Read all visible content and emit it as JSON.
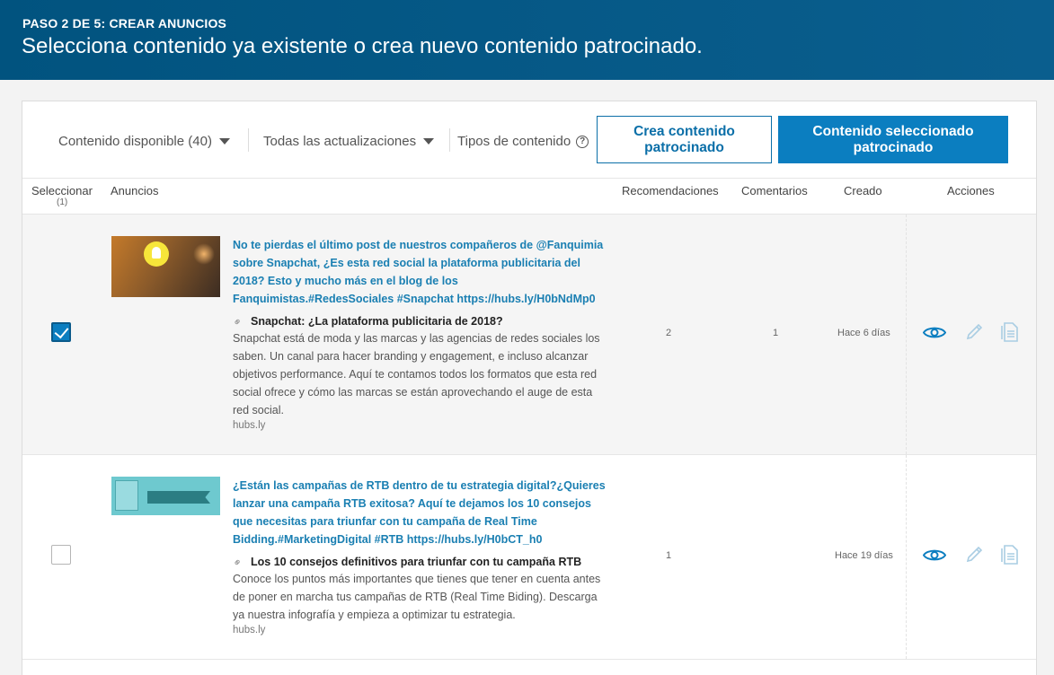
{
  "header": {
    "step": "PASO 2 DE 5: CREAR ANUNCIOS",
    "headline": "Selecciona contenido ya existente o crea nuevo contenido patrocinado."
  },
  "toolbar": {
    "filter_available": "Contenido disponible (40)",
    "filter_updates": "Todas las actualizaciones",
    "content_types": "Tipos de contenido",
    "create_button": "Crea contenido patrocinado",
    "selected_button": "Contenido seleccionado patrocinado"
  },
  "table": {
    "columns": {
      "select": "Seleccionar",
      "select_count": "(1)",
      "ads": "Anuncios",
      "recommendations": "Recomendaciones",
      "comments": "Comentarios",
      "created": "Creado",
      "actions": "Acciones"
    },
    "rows": [
      {
        "selected": true,
        "post_text": "No te pierdas el último post de nuestros compañeros de @Fanquimia sobre Snapchat, ¿Es esta red social la plataforma publicitaria del 2018? Esto y mucho más en el blog de los Fanquimistas.#RedesSociales #Snapchat https://hubs.ly/H0bNdMp0",
        "link_title": "Snapchat: ¿La plataforma publicitaria de 2018?",
        "link_description": "Snapchat está de moda y las marcas y las agencias de redes sociales los saben. Un canal para hacer branding y engagement, e incluso alcanzar objetivos performance. Aquí te contamos todos los formatos que esta red social ofrece y cómo las marcas se están aprovechando el auge de esta red social.",
        "domain": "hubs.ly",
        "recommendations": "2",
        "comments": "1",
        "created": "Hace 6 días"
      },
      {
        "selected": false,
        "post_text": "¿Están las campañas de RTB dentro de tu estrategia digital?¿Quieres lanzar una campaña RTB exitosa? Aquí te dejamos los 10 consejos que necesitas para triunfar con tu campaña de Real Time Bidding.#MarketingDigital #RTB https://hubs.ly/H0bCT_h0",
        "link_title": "Los 10 consejos definitivos para triunfar con tu campaña RTB",
        "link_description": "Conoce los puntos más importantes que tienes que tener en cuenta antes de poner en marcha tus campañas de RTB (Real Time Biding). Descarga ya nuestra infografía y empieza a optimizar tu estrategia.",
        "domain": "hubs.ly",
        "recommendations": "1",
        "comments": "",
        "created": "Hace 19 días"
      }
    ]
  },
  "icons": {
    "dropdown": "chevron-down-icon",
    "help": "question-circle-icon",
    "link": "link-icon",
    "view": "eye-icon",
    "edit": "pencil-icon",
    "copy": "document-copy-icon"
  },
  "colors": {
    "header_bg": "#01537f",
    "accent": "#0b7ec0",
    "link_text": "#1a7fb2"
  }
}
